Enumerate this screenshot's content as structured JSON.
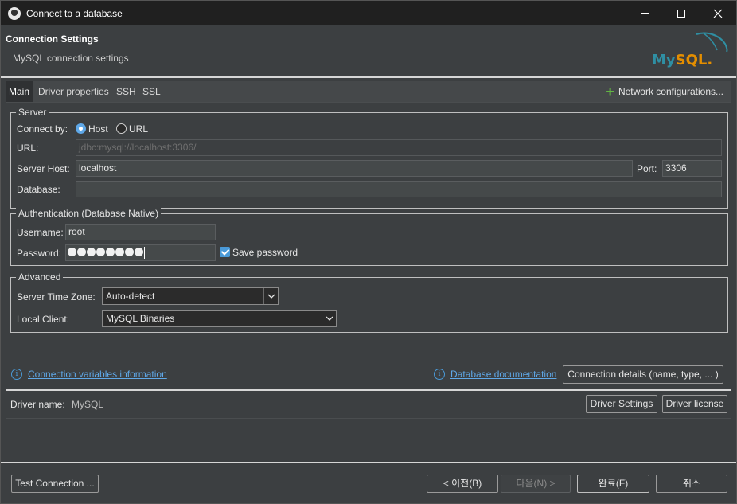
{
  "window": {
    "title": "Connect to a database"
  },
  "header": {
    "title": "Connection Settings",
    "subtitle": "MySQL connection settings",
    "logo_my": "My",
    "logo_sql": "SQL",
    "logo_dot": "."
  },
  "tabs": [
    {
      "label": "Main"
    },
    {
      "label": "Driver properties"
    },
    {
      "label": "SSH"
    },
    {
      "label": "SSL"
    }
  ],
  "network_configurations": "Network configurations...",
  "server": {
    "legend": "Server",
    "connect_by_label": "Connect by:",
    "option_host": "Host",
    "option_url": "URL",
    "selected": "Host",
    "url_label": "URL:",
    "url_value": "jdbc:mysql://localhost:3306/",
    "host_label": "Server Host:",
    "host_value": "localhost",
    "port_label": "Port:",
    "port_value": "3306",
    "database_label": "Database:",
    "database_value": ""
  },
  "auth": {
    "legend": "Authentication (Database Native)",
    "username_label": "Username:",
    "username_value": "root",
    "password_label": "Password:",
    "password_dot_count": 8,
    "save_password_label": "Save password",
    "save_password_checked": true
  },
  "advanced": {
    "legend": "Advanced",
    "timezone_label": "Server Time Zone:",
    "timezone_value": "Auto-detect",
    "local_client_label": "Local Client:",
    "local_client_value": "MySQL Binaries"
  },
  "links": {
    "connection_variables": "Connection variables information",
    "database_documentation": "Database documentation",
    "connection_details": "Connection details (name, type, ... )"
  },
  "driver": {
    "name_label": "Driver name:",
    "name_value": "MySQL",
    "settings_button": "Driver Settings",
    "license_button": "Driver license"
  },
  "footer": {
    "test_connection": "Test Connection ...",
    "back": "< 이전(B)",
    "next": "다음(N) >",
    "finish": "완료(F)",
    "cancel": "취소"
  },
  "colors": {
    "accent": "#5fa8e8",
    "mysql_blue": "#2f8fa3",
    "mysql_orange": "#e48e00",
    "plus_green": "#62b543"
  }
}
